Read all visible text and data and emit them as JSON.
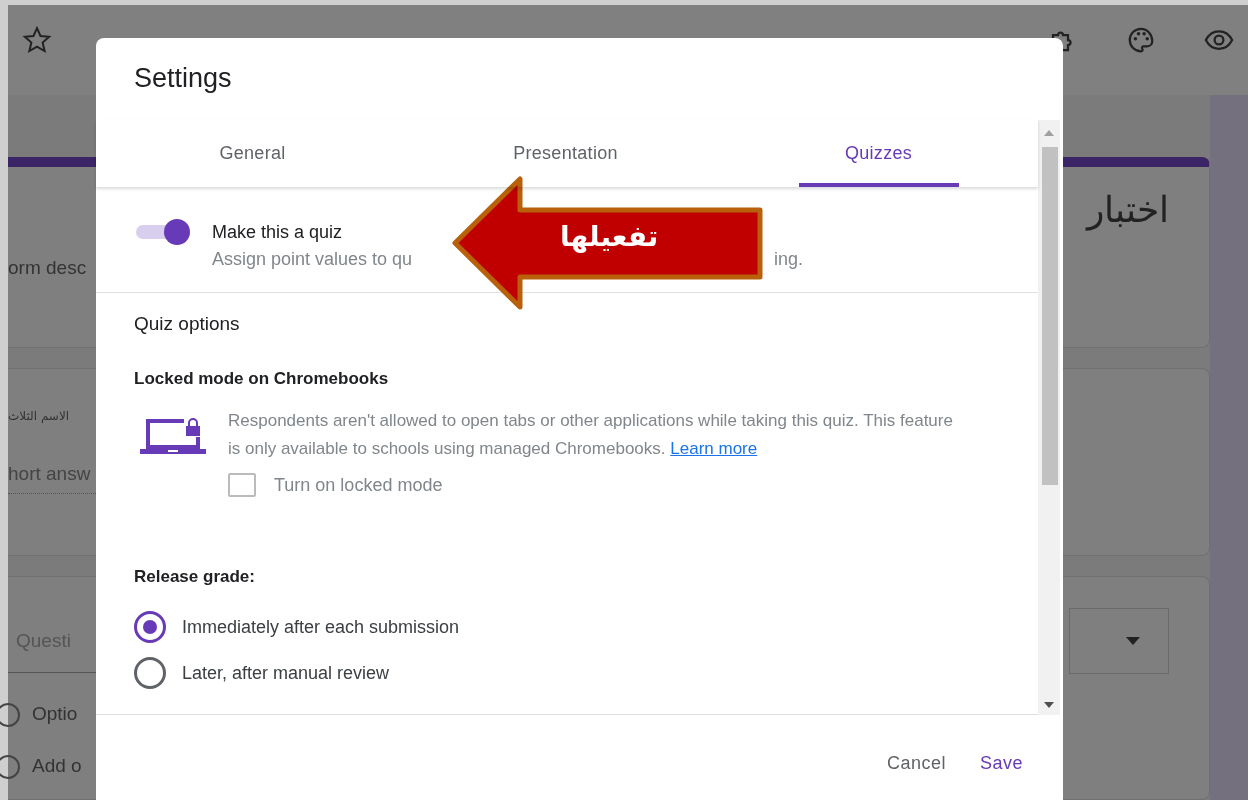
{
  "background": {
    "cards": [
      {
        "kind": "title",
        "right_text": "اختبار",
        "left_text": "orm desc"
      },
      {
        "kind": "question",
        "left_text": "الاسم الثلاث",
        "answer_hint": "hort answ"
      },
      {
        "kind": "choice",
        "field_text": "Questi",
        "options": [
          "Optio",
          "Add o"
        ]
      }
    ]
  },
  "dialog": {
    "title": "Settings",
    "tabs": [
      {
        "label": "General",
        "selected": false
      },
      {
        "label": "Presentation",
        "selected": false
      },
      {
        "label": "Quizzes",
        "selected": true
      }
    ],
    "quiz_toggle": {
      "label": "Make this a quiz",
      "on": true,
      "description_start": "Assign point values to qu",
      "description_end": "ing."
    },
    "section_title": "Quiz options",
    "locked_mode": {
      "heading": "Locked mode on Chromebooks",
      "text": "Respondents aren't allowed to open tabs or other applications while taking this quiz. This feature is only available to schools using managed Chromebooks.",
      "link": "Learn more",
      "checkbox": {
        "label": "Turn on locked mode",
        "checked": false
      }
    },
    "release_grade": {
      "heading": "Release grade:",
      "options": [
        {
          "label": "Immediately after each submission",
          "selected": true
        },
        {
          "label": "Later, after manual review",
          "selected": false
        }
      ]
    },
    "buttons": [
      {
        "label": "Cancel",
        "kind": "secondary"
      },
      {
        "label": "Save",
        "kind": "primary"
      }
    ]
  },
  "callout": {
    "label": "تفعيلها"
  }
}
